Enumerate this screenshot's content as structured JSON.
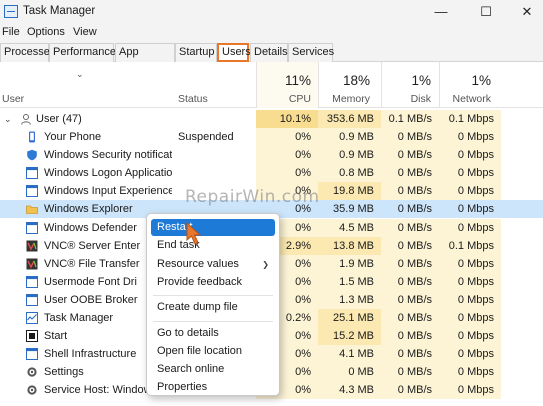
{
  "window": {
    "title": "Task Manager",
    "controls": {
      "minimize": "—",
      "maximize": "☐",
      "close": "✕"
    }
  },
  "menubar": {
    "items": [
      "File",
      "Options",
      "View"
    ]
  },
  "tabs": [
    "Processes",
    "Performance",
    "App history",
    "Startup",
    "Users",
    "Details",
    "Services"
  ],
  "active_tab": "Users",
  "columns": {
    "user": "User",
    "status": "Status",
    "cpu": {
      "pct": "11%",
      "label": "CPU"
    },
    "memory": {
      "pct": "18%",
      "label": "Memory"
    },
    "disk": {
      "pct": "1%",
      "label": "Disk"
    },
    "network": {
      "pct": "1%",
      "label": "Network"
    }
  },
  "user_group": {
    "label": "User (47)",
    "cpu": "10.1%",
    "memory": "353.6 MB",
    "disk": "0.1 MB/s",
    "network": "0.1 Mbps"
  },
  "processes": [
    {
      "name": "Your Phone",
      "status": "Suspended",
      "cpu": "0%",
      "memory": "0.9 MB",
      "disk": "0 MB/s",
      "network": "0 Mbps",
      "icon": "your-phone-icon",
      "color": "#3a6fd8"
    },
    {
      "name": "Windows Security notificat...",
      "status": "",
      "cpu": "0%",
      "memory": "0.9 MB",
      "disk": "0 MB/s",
      "network": "0 Mbps",
      "icon": "shield-icon",
      "color": "#2e7bd6"
    },
    {
      "name": "Windows Logon Application",
      "status": "",
      "cpu": "0%",
      "memory": "0.8 MB",
      "disk": "0 MB/s",
      "network": "0 Mbps",
      "icon": "window-icon",
      "color": "#2b6cc4"
    },
    {
      "name": "Windows Input Experience",
      "status": "",
      "cpu": "0%",
      "memory": "19.8 MB",
      "disk": "0 MB/s",
      "network": "0 Mbps",
      "icon": "window-icon",
      "color": "#2b6cc4"
    },
    {
      "name": "Windows Explorer",
      "status": "",
      "cpu": "0%",
      "memory": "35.9 MB",
      "disk": "0 MB/s",
      "network": "0 Mbps",
      "icon": "folder-icon",
      "color": "#f2c14e"
    },
    {
      "name": "Windows Defender",
      "status": "",
      "cpu": "0%",
      "memory": "4.5 MB",
      "disk": "0 MB/s",
      "network": "0 Mbps",
      "icon": "window-icon",
      "color": "#2b6cc4"
    },
    {
      "name": "VNC® Server Enter",
      "status": "",
      "cpu": "2.9%",
      "memory": "13.8 MB",
      "disk": "0 MB/s",
      "network": "0.1 Mbps",
      "icon": "vnc-icon",
      "color": "#333333"
    },
    {
      "name": "VNC® File Transfer",
      "status": "",
      "cpu": "0%",
      "memory": "1.9 MB",
      "disk": "0 MB/s",
      "network": "0 Mbps",
      "icon": "vnc-icon",
      "color": "#333333"
    },
    {
      "name": "Usermode Font Dri",
      "status": "",
      "cpu": "0%",
      "memory": "1.5 MB",
      "disk": "0 MB/s",
      "network": "0 Mbps",
      "icon": "window-icon",
      "color": "#2b6cc4"
    },
    {
      "name": "User OOBE Broker",
      "status": "",
      "cpu": "0%",
      "memory": "1.3 MB",
      "disk": "0 MB/s",
      "network": "0 Mbps",
      "icon": "window-icon",
      "color": "#2b6cc4"
    },
    {
      "name": "Task Manager",
      "status": "",
      "cpu": "0.2%",
      "memory": "25.1 MB",
      "disk": "0 MB/s",
      "network": "0 Mbps",
      "icon": "task-manager-icon",
      "color": "#2b6cc4"
    },
    {
      "name": "Start",
      "status": "",
      "cpu": "0%",
      "memory": "15.2 MB",
      "disk": "0 MB/s",
      "network": "0 Mbps",
      "icon": "start-icon",
      "color": "#1a1a1a"
    },
    {
      "name": "Shell Infrastructure",
      "status": "",
      "cpu": "0%",
      "memory": "4.1 MB",
      "disk": "0 MB/s",
      "network": "0 Mbps",
      "icon": "window-icon",
      "color": "#2b6cc4"
    },
    {
      "name": "Settings",
      "status": "",
      "cpu": "0%",
      "memory": "0 MB",
      "disk": "0 MB/s",
      "network": "0 Mbps",
      "icon": "gear-icon",
      "color": "#555555"
    },
    {
      "name": "Service Host: Windows Pus...",
      "status": "",
      "cpu": "0%",
      "memory": "4.3 MB",
      "disk": "0 MB/s",
      "network": "0 Mbps",
      "icon": "gear-icon",
      "color": "#555555"
    }
  ],
  "selected_row": "Windows Explorer",
  "context_menu": {
    "items": [
      {
        "label": "Restart",
        "highlight": true,
        "submenu": false
      },
      {
        "label": "End task",
        "highlight": false,
        "submenu": false
      },
      {
        "label": "Resource values",
        "highlight": false,
        "submenu": true
      },
      {
        "label": "Provide feedback",
        "highlight": false,
        "submenu": false
      },
      {
        "separator": true
      },
      {
        "label": "Create dump file",
        "highlight": false,
        "submenu": false
      },
      {
        "separator": true
      },
      {
        "label": "Go to details",
        "highlight": false,
        "submenu": false
      },
      {
        "label": "Open file location",
        "highlight": false,
        "submenu": false
      },
      {
        "label": "Search online",
        "highlight": false,
        "submenu": false
      },
      {
        "label": "Properties",
        "highlight": false,
        "submenu": false
      }
    ]
  },
  "watermark": "RepairWin.com",
  "colors": {
    "accent": "#e8772b",
    "highlight": "#1e7ad7",
    "selected_row": "#cde5fa",
    "heat_light": "#fdf4d6",
    "heat_medium": "#fbe9b1",
    "heat_strong": "#f8dd90"
  }
}
